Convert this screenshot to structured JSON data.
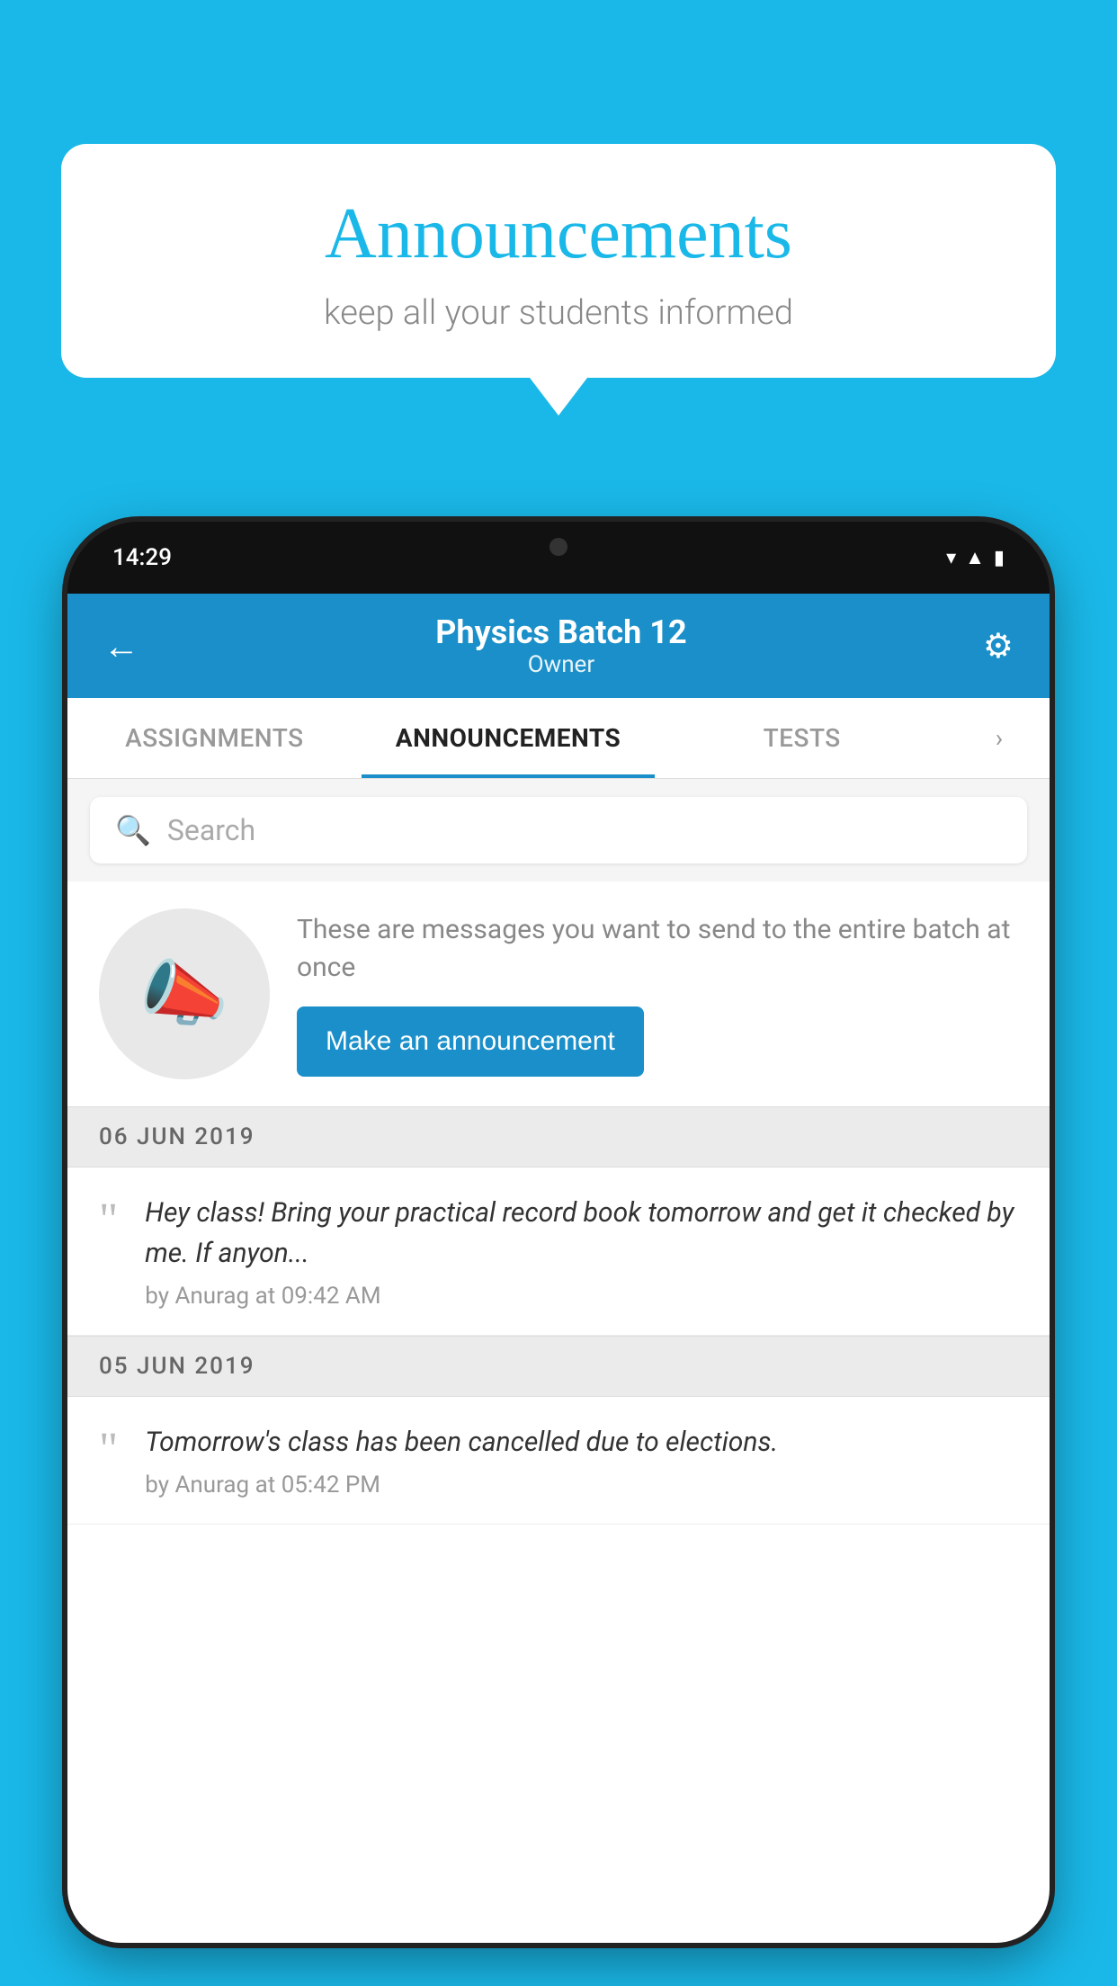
{
  "background_color": "#1ab8e8",
  "speech_bubble": {
    "title": "Announcements",
    "subtitle": "keep all your students informed"
  },
  "phone": {
    "status_bar": {
      "time": "14:29"
    },
    "header": {
      "title": "Physics Batch 12",
      "subtitle": "Owner",
      "back_label": "←",
      "settings_label": "⚙"
    },
    "tabs": [
      {
        "label": "ASSIGNMENTS",
        "active": false
      },
      {
        "label": "ANNOUNCEMENTS",
        "active": true
      },
      {
        "label": "TESTS",
        "active": false
      }
    ],
    "search": {
      "placeholder": "Search"
    },
    "promo": {
      "description": "These are messages you want to send to the entire batch at once",
      "button_label": "Make an announcement"
    },
    "announcements": [
      {
        "date": "06  JUN  2019",
        "text": "Hey class! Bring your practical record book tomorrow and get it checked by me. If anyon...",
        "meta": "by Anurag at 09:42 AM"
      },
      {
        "date": "05  JUN  2019",
        "text": "Tomorrow's class has been cancelled due to elections.",
        "meta": "by Anurag at 05:42 PM"
      }
    ]
  }
}
